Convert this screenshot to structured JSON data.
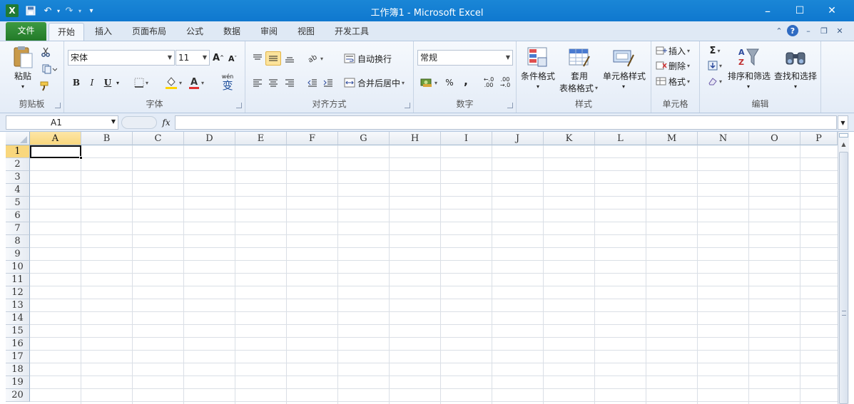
{
  "window": {
    "title": "工作簿1 - Microsoft Excel",
    "minimize": "–",
    "maximize": "☐",
    "close": "✕"
  },
  "qat": {
    "undo": "↶",
    "redo": "↷",
    "customize": "▾"
  },
  "tabs": [
    {
      "label": "文件"
    },
    {
      "label": "开始"
    },
    {
      "label": "插入"
    },
    {
      "label": "页面布局"
    },
    {
      "label": "公式"
    },
    {
      "label": "数据"
    },
    {
      "label": "审阅"
    },
    {
      "label": "视图"
    },
    {
      "label": "开发工具"
    }
  ],
  "ribbon": {
    "clipboard": {
      "label": "剪贴板",
      "paste": "粘贴"
    },
    "font": {
      "label": "字体",
      "name": "宋体",
      "size": "11",
      "bold": "B",
      "italic": "I",
      "underline": "U",
      "wen": "wén",
      "wen_char": "变"
    },
    "alignment": {
      "label": "对齐方式",
      "wrap": "自动换行",
      "merge": "合并后居中"
    },
    "number": {
      "label": "数字",
      "format": "常规",
      "percent": "%",
      "comma": ","
    },
    "styles": {
      "label": "样式",
      "conditional": "条件格式",
      "table_line1": "套用",
      "table_line2": "表格格式",
      "cell_styles": "单元格样式"
    },
    "cells": {
      "label": "单元格",
      "insert": "插入",
      "delete": "删除",
      "format": "格式"
    },
    "editing": {
      "label": "编辑",
      "sort": "排序和筛选",
      "find": "查找和选择",
      "sigma": "Σ"
    }
  },
  "formula_bar": {
    "name_box": "A1",
    "fx": "fx",
    "value": ""
  },
  "grid": {
    "columns": [
      "A",
      "B",
      "C",
      "D",
      "E",
      "F",
      "G",
      "H",
      "I",
      "J",
      "K",
      "L",
      "M",
      "N",
      "O",
      "P"
    ],
    "rows": [
      "1",
      "2",
      "3",
      "4",
      "5",
      "6",
      "7",
      "8",
      "9",
      "10",
      "11",
      "12",
      "13",
      "14",
      "15",
      "16",
      "17",
      "18",
      "19",
      "20"
    ],
    "selected_cell": "A1"
  },
  "colors": {
    "title_bar": "#1a86d6",
    "file_tab": "#2e8b35",
    "highlight": "#f9d77d"
  }
}
